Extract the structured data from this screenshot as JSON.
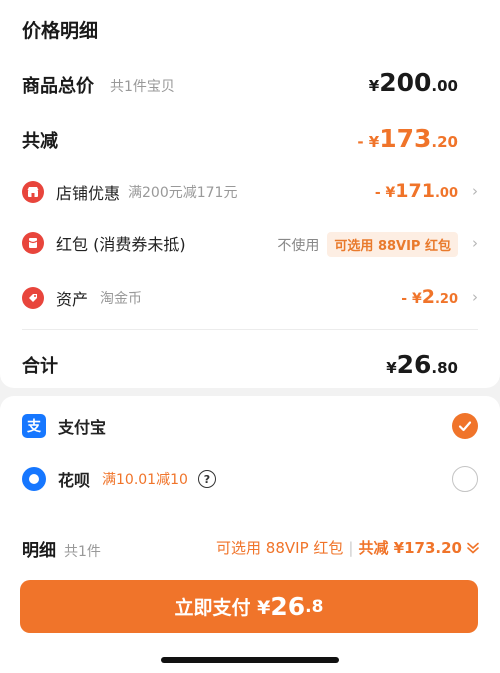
{
  "header": {
    "title": "价格明细"
  },
  "total_goods": {
    "label": "商品总价",
    "note": "共1件宝贝",
    "symbol": "¥",
    "int": "200",
    "dec": ".00"
  },
  "discount": {
    "label": "共减",
    "prefix": "- ¥",
    "int": "173",
    "dec": ".20"
  },
  "store_promo": {
    "label": "店铺优惠",
    "note": "满200元减171元",
    "prefix": "- ¥",
    "int": "171",
    "dec": ".00"
  },
  "red_packet": {
    "label": "红包 (消费券未抵)",
    "status": "不使用",
    "badge": "可选用 88VIP 红包"
  },
  "assets": {
    "label": "资产",
    "note": "淘金币",
    "prefix": "- ¥",
    "int": "2",
    "dec": ".20"
  },
  "subtotal": {
    "label": "合计",
    "symbol": "¥",
    "int": "26",
    "dec": ".80"
  },
  "payment_methods": [
    {
      "label": "支付宝",
      "selected": true
    },
    {
      "label": "花呗",
      "promo": "满10.01减10",
      "selected": false
    }
  ],
  "summary_bar": {
    "label": "明细",
    "count": "共1件",
    "vip_note": "可选用 88VIP 红包",
    "separator": "|",
    "total_discount": "共减 ¥173.20"
  },
  "pay_button": {
    "label": "立即支付 ¥",
    "int": "26",
    "dec": ".8"
  },
  "colors": {
    "accent": "#f0742a",
    "red_icon": "#e8453c",
    "alipay_blue": "#1677ff",
    "badge_bg": "#fdeee3"
  },
  "icons": {
    "store": "store-icon",
    "red_packet": "red-packet-icon",
    "assets": "coin-tag-icon",
    "alipay": "alipay-icon",
    "huabei": "huabei-icon",
    "help": "question-circle-icon",
    "chevron": "chevron-right-icon",
    "expand": "double-chevron-down-icon",
    "check": "check-icon"
  }
}
